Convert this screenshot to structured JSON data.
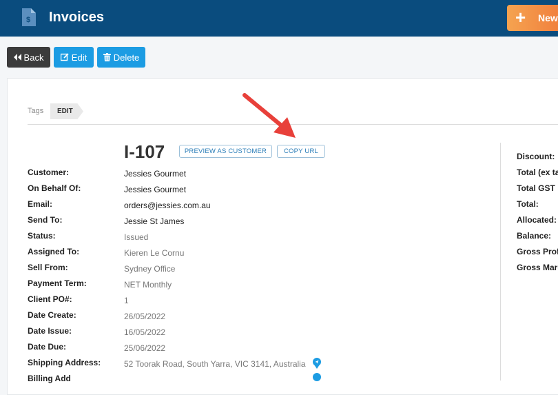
{
  "header": {
    "title": "Invoices",
    "new_label": "New"
  },
  "toolbar": {
    "back_label": "Back",
    "edit_label": "Edit",
    "delete_label": "Delete"
  },
  "tags": {
    "label": "Tags",
    "edit_label": "EDIT"
  },
  "invoice": {
    "number": "I-107",
    "preview_label": "PREVIEW AS CUSTOMER",
    "copy_url_label": "COPY URL"
  },
  "fields": [
    {
      "label": "Customer:",
      "value": "Jessies Gourmet"
    },
    {
      "label": "On Behalf Of:",
      "value": "Jessies Gourmet"
    },
    {
      "label": "Email:",
      "value": "orders@jessies.com.au"
    },
    {
      "label": "Send To:",
      "value": "Jessie St James"
    },
    {
      "label": "Status:",
      "value": "Issued"
    },
    {
      "label": "Assigned To:",
      "value": "Kieren Le Cornu"
    },
    {
      "label": "Sell From:",
      "value": "Sydney Office"
    },
    {
      "label": "Payment Term:",
      "value": "NET Monthly"
    },
    {
      "label": "Client PO#:",
      "value": "1"
    },
    {
      "label": "Date Create:",
      "value": "26/05/2022"
    },
    {
      "label": "Date Issue:",
      "value": "16/05/2022"
    },
    {
      "label": "Date Due:",
      "value": "25/06/2022"
    },
    {
      "label": "Shipping Address:",
      "value": "52 Toorak Road, South Yarra, VIC 3141, Australia"
    },
    {
      "label": "Billing Add",
      "value": ""
    }
  ],
  "totals": [
    {
      "label": "Discount:"
    },
    {
      "label": "Total (ex ta"
    },
    {
      "label": "Total GST"
    },
    {
      "label": "Total:"
    },
    {
      "label": "Allocated:"
    },
    {
      "label": "Balance:"
    },
    {
      "label": "Gross Prof"
    },
    {
      "label": "Gross Marg"
    }
  ],
  "colors": {
    "header_bg": "#0a4c7e",
    "primary": "#1c9ce3",
    "new_button": "#f28c45",
    "arrow": "#e8403a"
  },
  "icons": [
    "invoice-icon",
    "plus-icon",
    "back-icon",
    "edit-icon",
    "trash-icon",
    "location-icon"
  ]
}
